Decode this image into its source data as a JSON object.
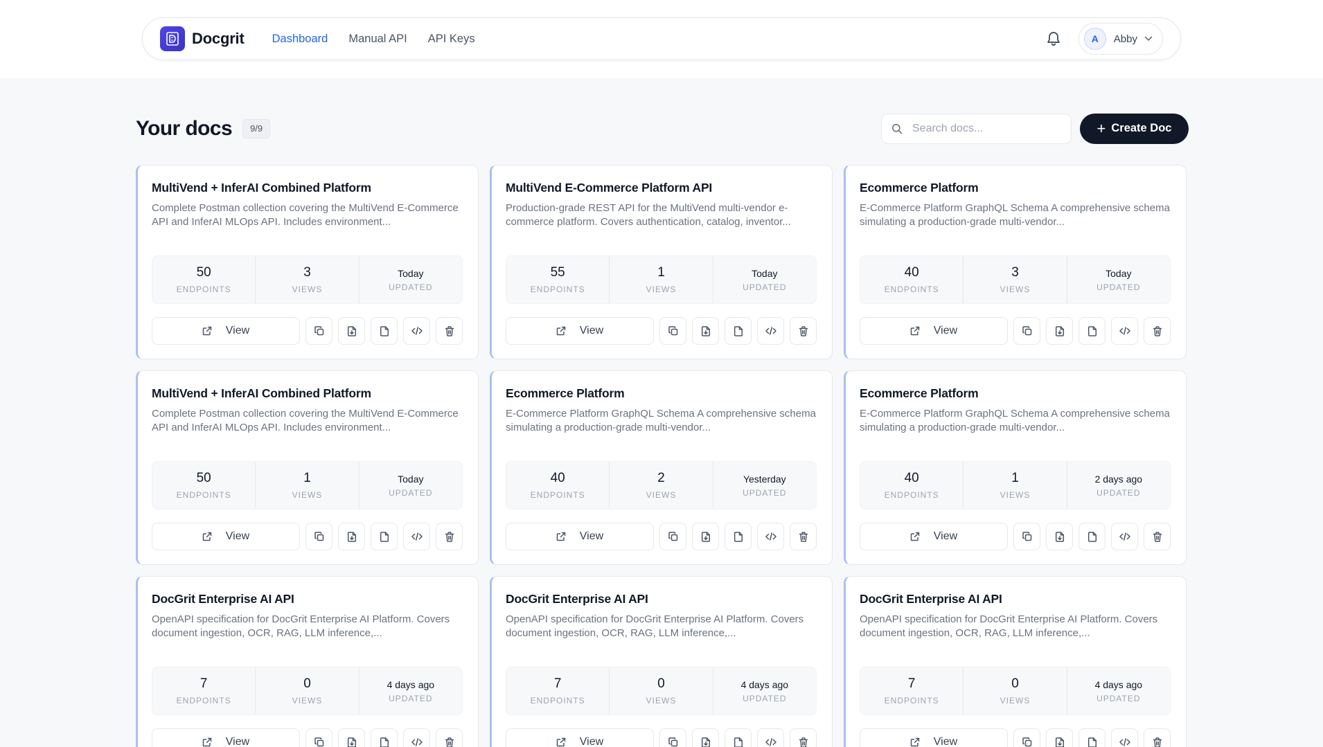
{
  "app": {
    "brand": "Docgrit",
    "nav": [
      {
        "label": "Dashboard",
        "active": true
      },
      {
        "label": "Manual API",
        "active": false
      },
      {
        "label": "API Keys",
        "active": false
      }
    ],
    "user": {
      "initial": "A",
      "name": "Abby"
    }
  },
  "page": {
    "title": "Your docs",
    "count": "9/9",
    "search_placeholder": "Search docs...",
    "create_label": "Create Doc"
  },
  "labels": {
    "endpoints": "ENDPOINTS",
    "views": "VIEWS",
    "updated": "UPDATED",
    "view": "View"
  },
  "docs": [
    {
      "title": "MultiVend + InferAI Combined Platform",
      "description": "Complete Postman collection covering the MultiVend E-Commerce API and InferAI MLOps API. Includes environment...",
      "endpoints": "50",
      "views": "3",
      "updated": "Today"
    },
    {
      "title": "MultiVend E-Commerce Platform API",
      "description": "Production-grade REST API for the MultiVend multi-vendor e-commerce platform. Covers authentication, catalog, inventor...",
      "endpoints": "55",
      "views": "1",
      "updated": "Today"
    },
    {
      "title": "Ecommerce Platform",
      "description": "E-Commerce Platform GraphQL Schema A comprehensive schema simulating a production-grade multi-vendor...",
      "endpoints": "40",
      "views": "3",
      "updated": "Today"
    },
    {
      "title": "MultiVend + InferAI Combined Platform",
      "description": "Complete Postman collection covering the MultiVend E-Commerce API and InferAI MLOps API. Includes environment...",
      "endpoints": "50",
      "views": "1",
      "updated": "Today"
    },
    {
      "title": "Ecommerce Platform",
      "description": "E-Commerce Platform GraphQL Schema A comprehensive schema simulating a production-grade multi-vendor...",
      "endpoints": "40",
      "views": "2",
      "updated": "Yesterday"
    },
    {
      "title": "Ecommerce Platform",
      "description": "E-Commerce Platform GraphQL Schema A comprehensive schema simulating a production-grade multi-vendor...",
      "endpoints": "40",
      "views": "1",
      "updated": "2 days ago"
    },
    {
      "title": "DocGrit Enterprise AI API",
      "description": "OpenAPI specification for DocGrit Enterprise AI Platform. Covers document ingestion, OCR, RAG, LLM inference,...",
      "endpoints": "7",
      "views": "0",
      "updated": "4 days ago"
    },
    {
      "title": "DocGrit Enterprise AI API",
      "description": "OpenAPI specification for DocGrit Enterprise AI Platform. Covers document ingestion, OCR, RAG, LLM inference,...",
      "endpoints": "7",
      "views": "0",
      "updated": "4 days ago"
    },
    {
      "title": "DocGrit Enterprise AI API",
      "description": "OpenAPI specification for DocGrit Enterprise AI Platform. Covers document ingestion, OCR, RAG, LLM inference,...",
      "endpoints": "7",
      "views": "0",
      "updated": "4 days ago"
    }
  ],
  "icons": {
    "brand": "docgrit-logo-icon",
    "notifications": "bell-icon",
    "user_menu": "chevron-down-icon",
    "search": "search-icon",
    "create": "plus-icon",
    "view": "external-link-icon",
    "card_actions": [
      "copy-icon",
      "file-import-icon",
      "file-icon",
      "code-icon",
      "trash-icon"
    ]
  },
  "colors": {
    "accent": "#2563eb",
    "brand": "#4f46e5",
    "primary_button": "#111827",
    "card_accent": "#a9bff3"
  }
}
